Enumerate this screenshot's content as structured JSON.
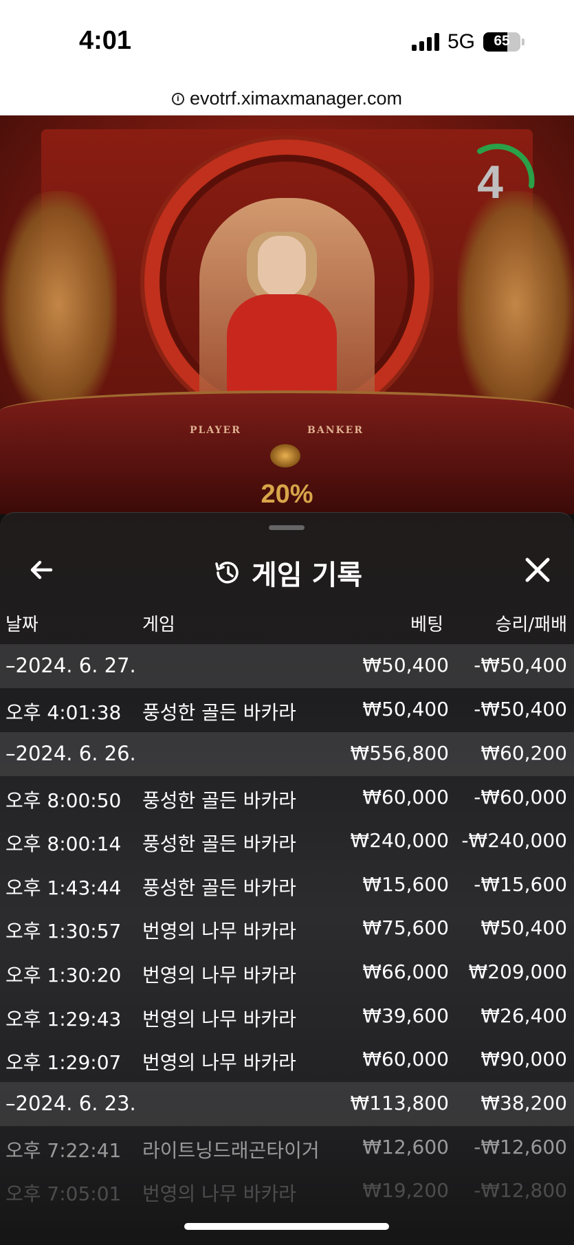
{
  "status_bar": {
    "time": "4:01",
    "network": "5G",
    "battery": "65",
    "battery_level_percent": 65
  },
  "browser": {
    "url": "evotrf.ximaxmanager.com",
    "info_icon": "info-icon"
  },
  "game": {
    "countdown": "4",
    "table_labels": {
      "player": "PLAYER",
      "banker": "BANKER"
    },
    "multiplier_percent": "20%"
  },
  "panel": {
    "title": "게임 기록",
    "title_icon": "history-icon",
    "back_icon": "arrow-left-icon",
    "close_icon": "close-icon",
    "columns": {
      "date": "날짜",
      "game": "게임",
      "bet": "베팅",
      "result": "승리/패배"
    },
    "rows": [
      {
        "type": "group",
        "date": "–2024. 6. 27.",
        "bet": "₩50,400",
        "result": "-₩50,400"
      },
      {
        "type": "item",
        "date": "오후 4:01:38",
        "game": "풍성한 골든 바카라",
        "bet": "₩50,400",
        "result": "-₩50,400"
      },
      {
        "type": "group",
        "date": "–2024. 6. 26.",
        "bet": "₩556,800",
        "result": "₩60,200"
      },
      {
        "type": "item",
        "date": "오후 8:00:50",
        "game": "풍성한 골든 바카라",
        "bet": "₩60,000",
        "result": "-₩60,000"
      },
      {
        "type": "item",
        "date": "오후 8:00:14",
        "game": "풍성한 골든 바카라",
        "bet": "₩240,000",
        "result": "-₩240,000"
      },
      {
        "type": "item",
        "date": "오후 1:43:44",
        "game": "풍성한 골든 바카라",
        "bet": "₩15,600",
        "result": "-₩15,600"
      },
      {
        "type": "item",
        "date": "오후 1:30:57",
        "game": "번영의 나무 바카라",
        "bet": "₩75,600",
        "result": "₩50,400"
      },
      {
        "type": "item",
        "date": "오후 1:30:20",
        "game": "번영의 나무 바카라",
        "bet": "₩66,000",
        "result": "₩209,000"
      },
      {
        "type": "item",
        "date": "오후 1:29:43",
        "game": "번영의 나무 바카라",
        "bet": "₩39,600",
        "result": "₩26,400"
      },
      {
        "type": "item",
        "date": "오후 1:29:07",
        "game": "번영의 나무 바카라",
        "bet": "₩60,000",
        "result": "₩90,000"
      },
      {
        "type": "group",
        "date": "–2024. 6. 23.",
        "bet": "₩113,800",
        "result": "₩38,200"
      },
      {
        "type": "item",
        "date": "오후 7:22:41",
        "game": "라이트닝드래곤타이거",
        "bet": "₩12,600",
        "result": "-₩12,600"
      },
      {
        "type": "item",
        "date": "오후 7:05:01",
        "game": "번영의 나무 바카라",
        "bet": "₩19,200",
        "result": "-₩12,800"
      }
    ]
  }
}
